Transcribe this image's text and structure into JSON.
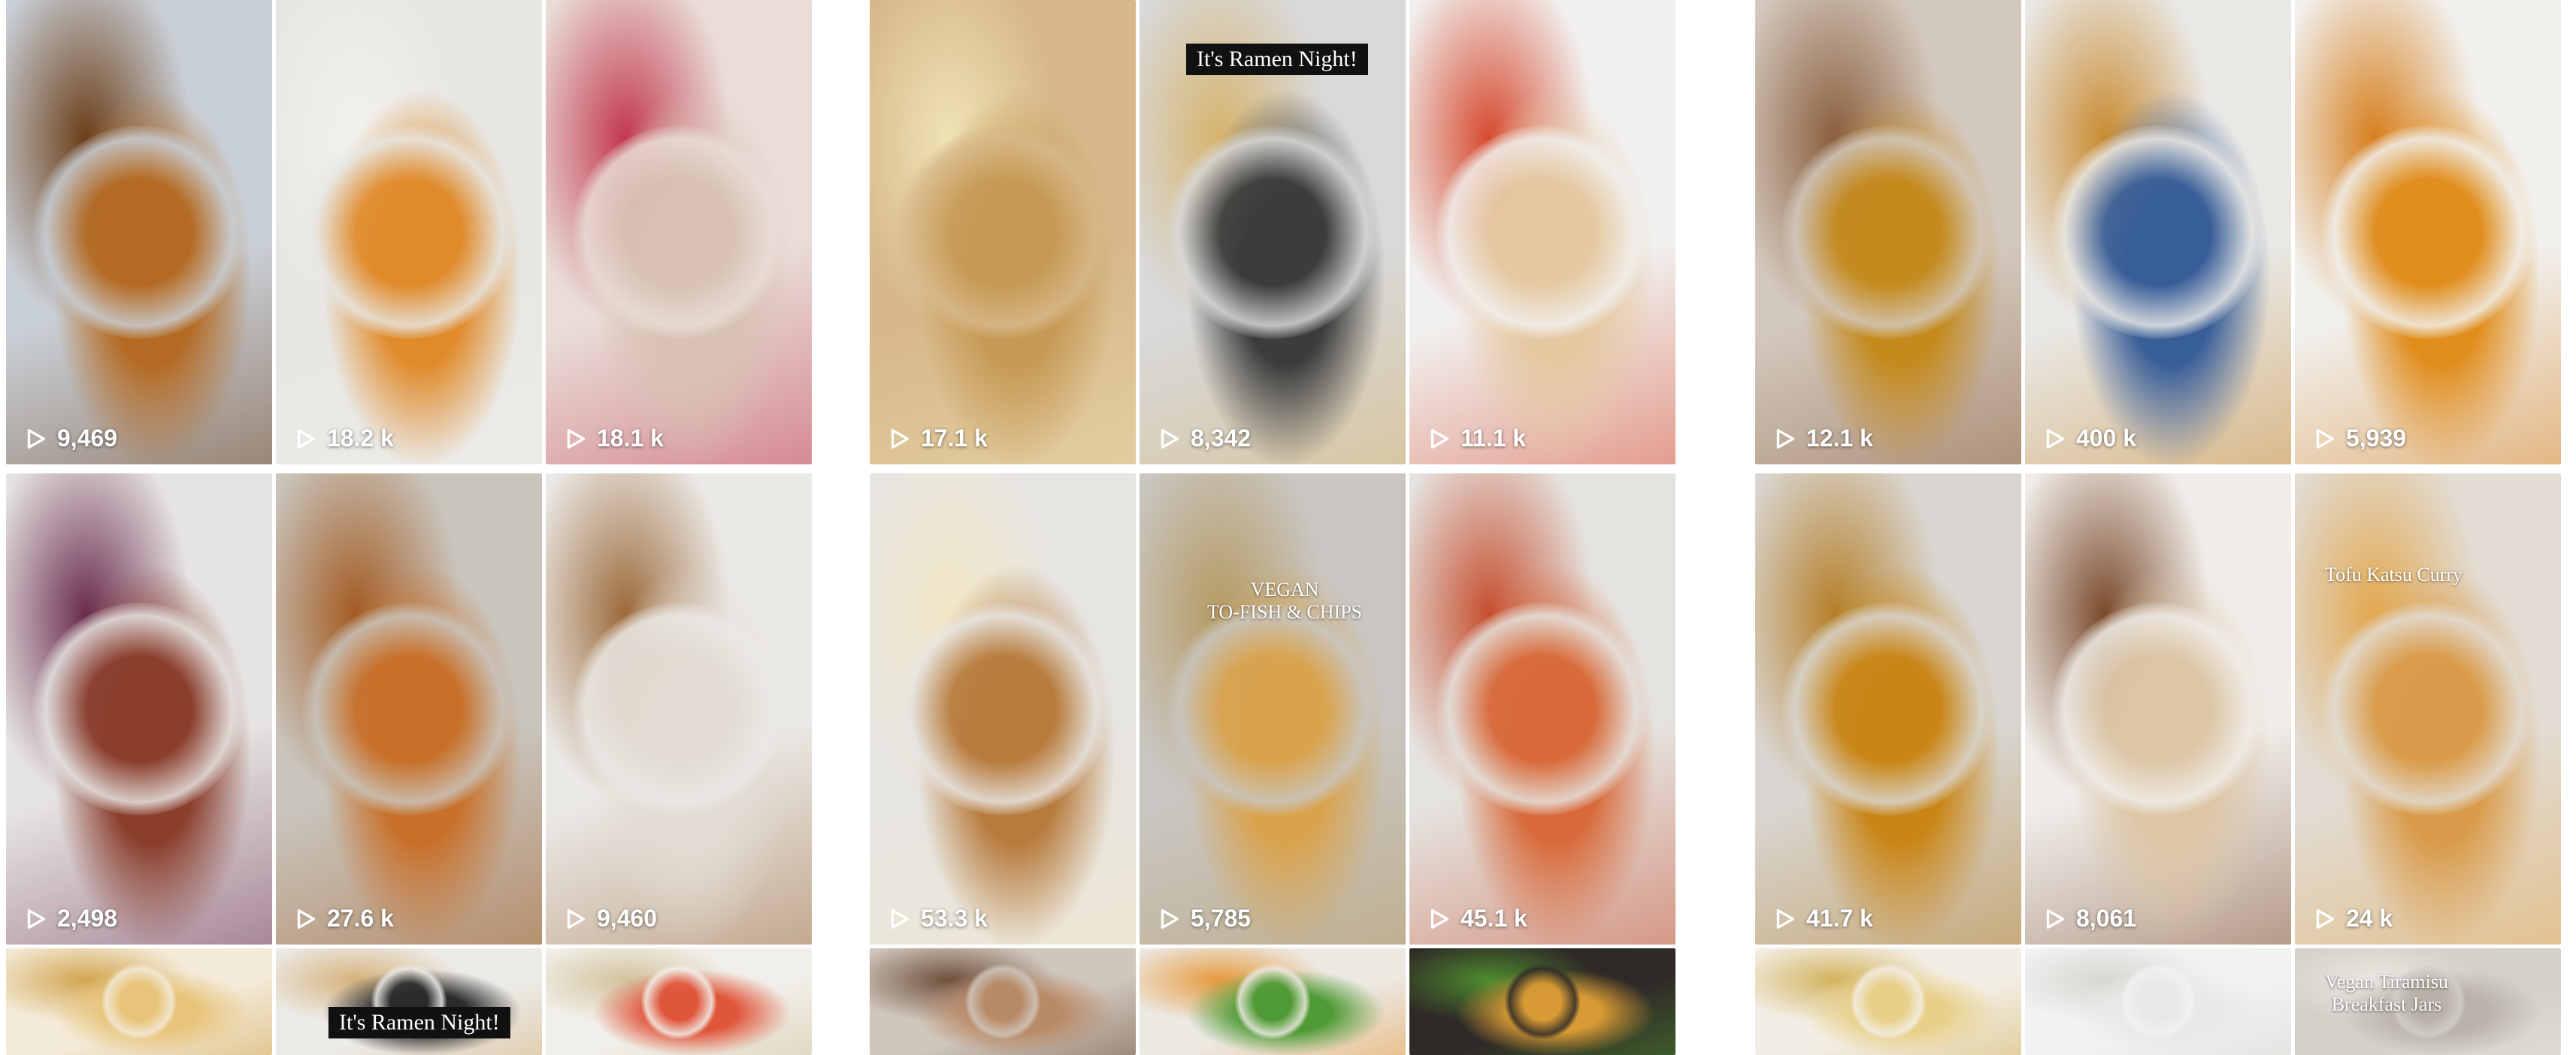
{
  "panels": [
    {
      "tiles": [
        {
          "views": "9,469",
          "colors": [
            "#c9cfd6",
            "#b46a22",
            "#6b3e18"
          ]
        },
        {
          "views": "18.2 k",
          "colors": [
            "#e7e6e2",
            "#e08a2a",
            "#f2f1ee"
          ]
        },
        {
          "views": "18.1 k",
          "colors": [
            "#e9ddd6",
            "#d7c2b4",
            "#c2384f"
          ]
        },
        {
          "views": "2,498",
          "colors": [
            "#e6e4e2",
            "#8a3e2c",
            "#6a2c4e"
          ]
        },
        {
          "views": "27.6 k",
          "colors": [
            "#c9c5bd",
            "#c8702a",
            "#a35b22"
          ]
        },
        {
          "views": "9,460",
          "colors": [
            "#ebe9e6",
            "#e2dcd2",
            "#9b6a3a"
          ]
        },
        {
          "views": "",
          "colors": [
            "#f3ead8",
            "#e8c47a",
            "#d2a54f"
          ]
        },
        {
          "views": "",
          "colors": [
            "#ecebe8",
            "#2b2b2b",
            "#d6b27c"
          ],
          "caption": "It's Ramen Night!"
        },
        {
          "views": "",
          "colors": [
            "#f1efe9",
            "#e0563b",
            "#d3c39d"
          ]
        }
      ]
    },
    {
      "tiles": [
        {
          "views": "17.1 k",
          "colors": [
            "#d7b88a",
            "#c69a55",
            "#efe3b6"
          ]
        },
        {
          "views": "8,342",
          "colors": [
            "#d9d9d9",
            "#3c3c3c",
            "#d6b46d"
          ],
          "caption": "It's Ramen Night!"
        },
        {
          "views": "11.1 k",
          "colors": [
            "#f1f0ee",
            "#e5c9a2",
            "#d64a2f"
          ]
        },
        {
          "views": "53.3 k",
          "colors": [
            "#e7e5e2",
            "#b77b3c",
            "#f2e7c6"
          ]
        },
        {
          "views": "5,785",
          "colors": [
            "#c9c6c1",
            "#d9a34e",
            "#b59a62"
          ],
          "caption": "VEGAN\nTO-FISH & CHIPS"
        },
        {
          "views": "45.1 k",
          "colors": [
            "#e5e3df",
            "#d86a3a",
            "#c64e2e"
          ]
        },
        {
          "views": "",
          "colors": [
            "#cfc6bc",
            "#b98a66",
            "#6e4f3b"
          ]
        },
        {
          "views": "",
          "colors": [
            "#ece8e2",
            "#4f9a34",
            "#e69a3c"
          ]
        },
        {
          "views": "",
          "colors": [
            "#2f2a27",
            "#d79a35",
            "#4d8c2e"
          ]
        }
      ]
    },
    {
      "tiles": [
        {
          "views": "12.1 k",
          "colors": [
            "#d3c8bd",
            "#c48a1d",
            "#8a5e3d"
          ]
        },
        {
          "views": "400 k",
          "colors": [
            "#e9e8e5",
            "#385e98",
            "#c98b31"
          ]
        },
        {
          "views": "5,939",
          "colors": [
            "#f1f0ed",
            "#e08d1c",
            "#d67f1d"
          ]
        },
        {
          "views": "41.7 k",
          "colors": [
            "#d9d6d1",
            "#c98617",
            "#b57f28"
          ]
        },
        {
          "views": "8,061",
          "colors": [
            "#f0ede9",
            "#dcc6a5",
            "#7a4a2c"
          ]
        },
        {
          "views": "24 k",
          "colors": [
            "#e2dcd3",
            "#d99b49",
            "#e2a850"
          ],
          "caption": "Tofu Katsu Curry"
        },
        {
          "views": "",
          "colors": [
            "#f3eee5",
            "#e8d08a",
            "#d2b25c"
          ]
        },
        {
          "views": "",
          "colors": [
            "#f2f2f1",
            "#e9e8e6",
            "#d8d6d2"
          ]
        },
        {
          "views": "",
          "colors": [
            "#d3cfc9",
            "#b9b2a8",
            "#eae6e0"
          ],
          "caption": "Vegan Tiramisu\nBreakfast Jars"
        }
      ]
    }
  ]
}
